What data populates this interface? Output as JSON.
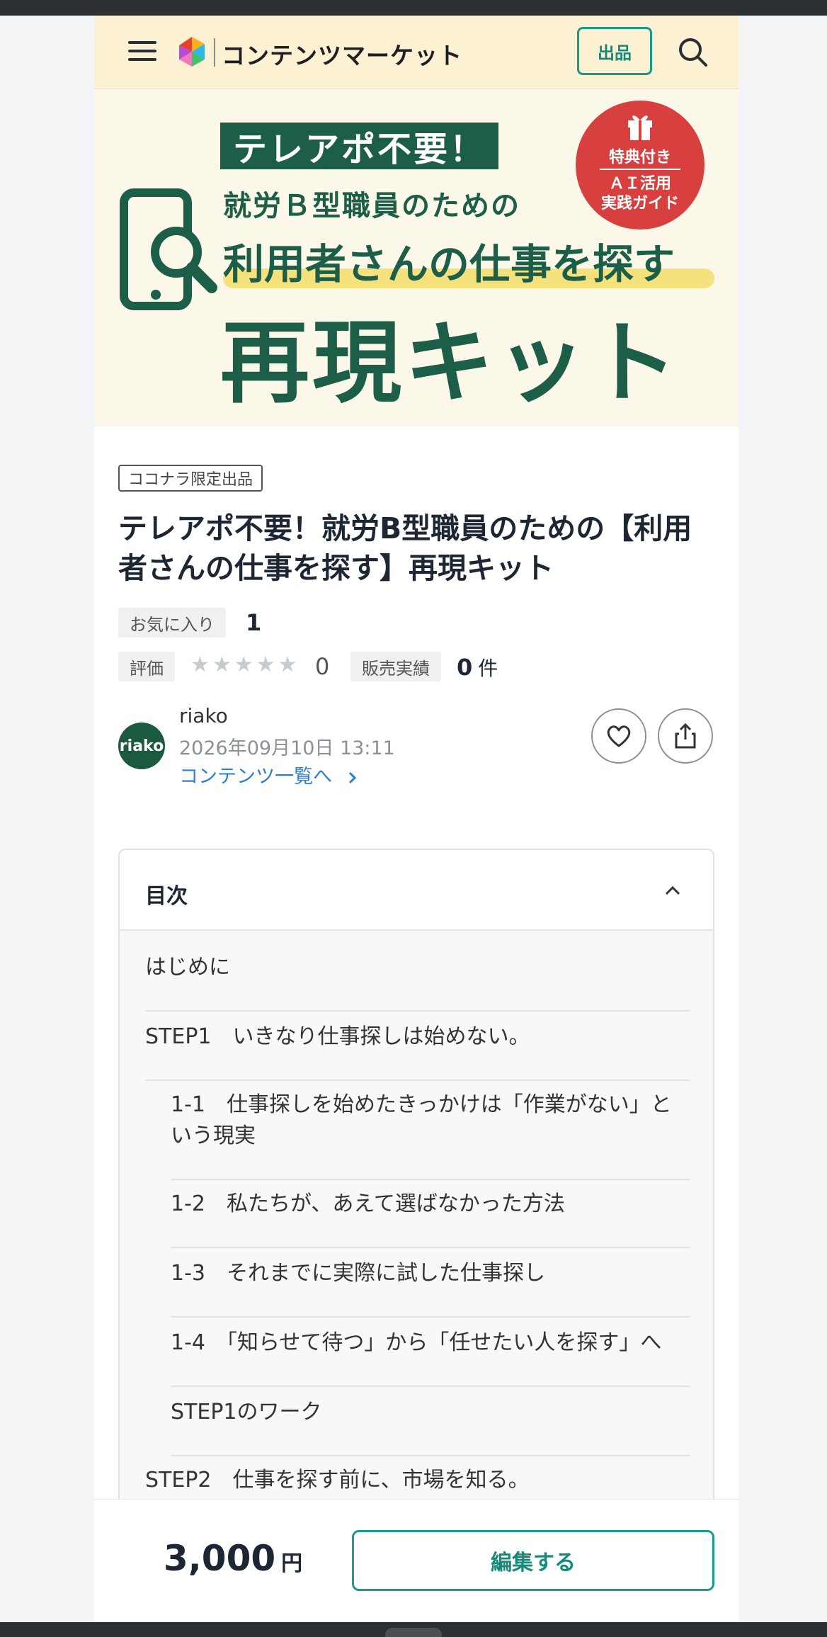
{
  "header": {
    "logo_text": "コンテンツマーケット",
    "sell_label": "出品"
  },
  "banner": {
    "headline": "テレアポ不要！",
    "subline": "就労Ｂ型職員のための",
    "main_line": "利用者さんの仕事を探す",
    "big_line": "再現キット",
    "bonus_label": "特典付き",
    "bonus_line1": "ＡＩ活用",
    "bonus_line2": "実践ガイド"
  },
  "product": {
    "limited_tag": "ココナラ限定出品",
    "title": "テレアポ不要！就労B型職員のための【利用者さんの仕事を探す】再現キット",
    "favorite_label": "お気に入り",
    "favorite_count": "1",
    "rating_label": "評価",
    "rating_value": "0",
    "rating_stars": 0,
    "sales_label": "販売実績",
    "sales_count": "0",
    "sales_unit": "件"
  },
  "seller": {
    "avatar_text": "riako",
    "name": "riako",
    "date": "2026年09月10日 13:11",
    "content_link": "コンテンツ一覧へ"
  },
  "toc": {
    "title": "目次",
    "items": [
      {
        "label": "はじめに",
        "level": 0
      },
      {
        "label": "STEP1　いきなり仕事探しは始めない。",
        "level": 0
      },
      {
        "label": "1-1　仕事探しを始めたきっかけは「作業がない」という現実",
        "level": 1
      },
      {
        "label": "1-2　私たちが、あえて選ばなかった方法",
        "level": 1
      },
      {
        "label": "1-3　それまでに実際に試した仕事探し",
        "level": 1
      },
      {
        "label": "1-4　「知らせて待つ」から「任せたい人を探す」へ",
        "level": 1
      },
      {
        "label": "STEP1のワーク",
        "level": 1
      },
      {
        "label": "STEP2　仕事を探す前に、市場を知る。",
        "level": 0
      }
    ]
  },
  "footer": {
    "price": "3,000",
    "price_unit": "円",
    "edit_label": "編集する"
  },
  "colors": {
    "accent": "#1a9a88",
    "banner_green": "#1c5e48",
    "header_bg": "#fdf1d3",
    "badge_red": "#d84040",
    "link_blue": "#2a7fd4"
  }
}
